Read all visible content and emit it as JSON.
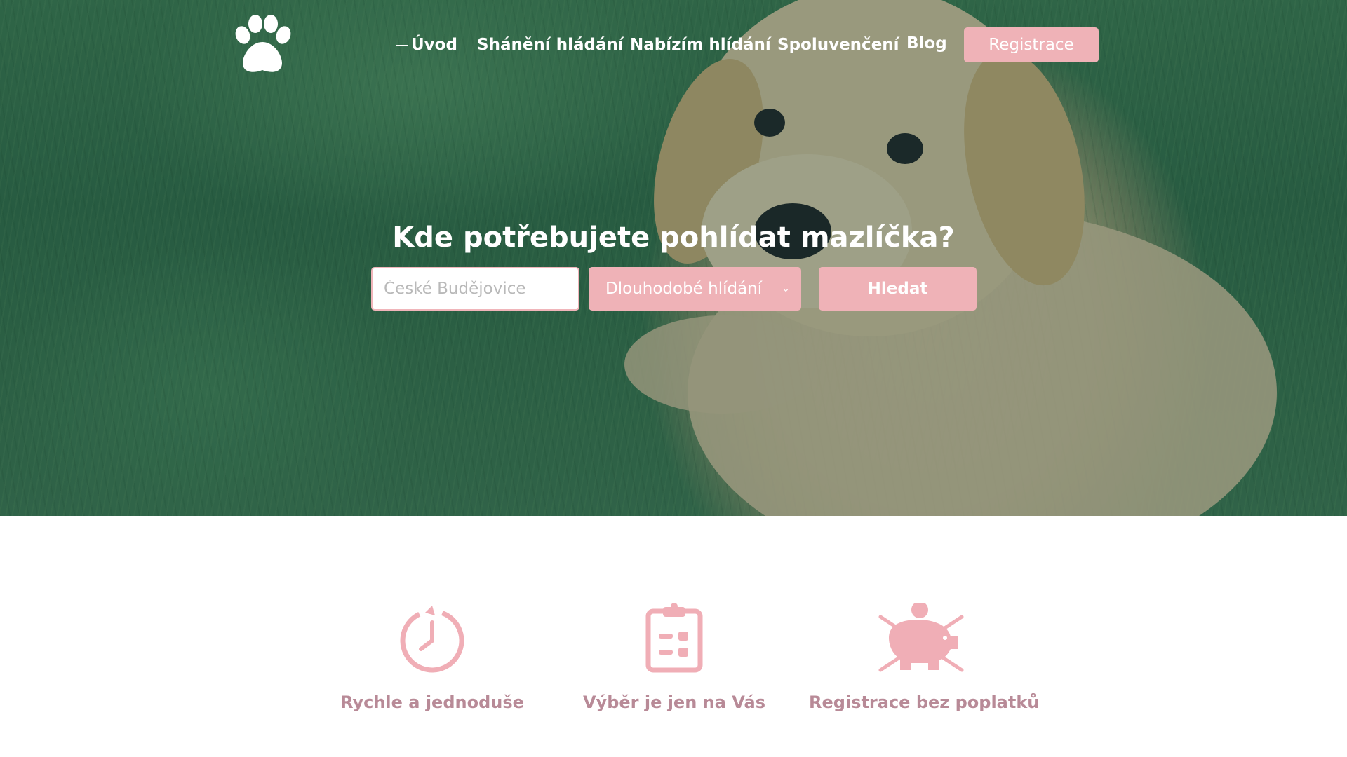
{
  "nav": {
    "items": [
      {
        "label": "Úvod",
        "active": true
      },
      {
        "label": "Shánění hládání",
        "active": false
      },
      {
        "label": "Nabízím hlídání",
        "active": false
      },
      {
        "label": "Spoluvenčení",
        "active": false
      },
      {
        "label": "Blog",
        "active": false
      }
    ],
    "register_label": "Registrace"
  },
  "hero": {
    "title": "Kde potřebujete pohlídat mazlíčka?"
  },
  "search": {
    "placeholder": "České Budějovice",
    "value": "",
    "type_selected": "Dlouhodobé hlídání",
    "button_label": "Hledat"
  },
  "features": [
    {
      "label": "Rychle a jednoduše",
      "icon": "stopwatch-icon"
    },
    {
      "label": "Výběr je jen na Vás",
      "icon": "clipboard-icon"
    },
    {
      "label": "Registrace bez poplatků",
      "icon": "piggy-bank-icon"
    }
  ],
  "colors": {
    "accent": "#efb2b7",
    "feature_text": "#b88a97",
    "icon": "#f0aeb6"
  }
}
